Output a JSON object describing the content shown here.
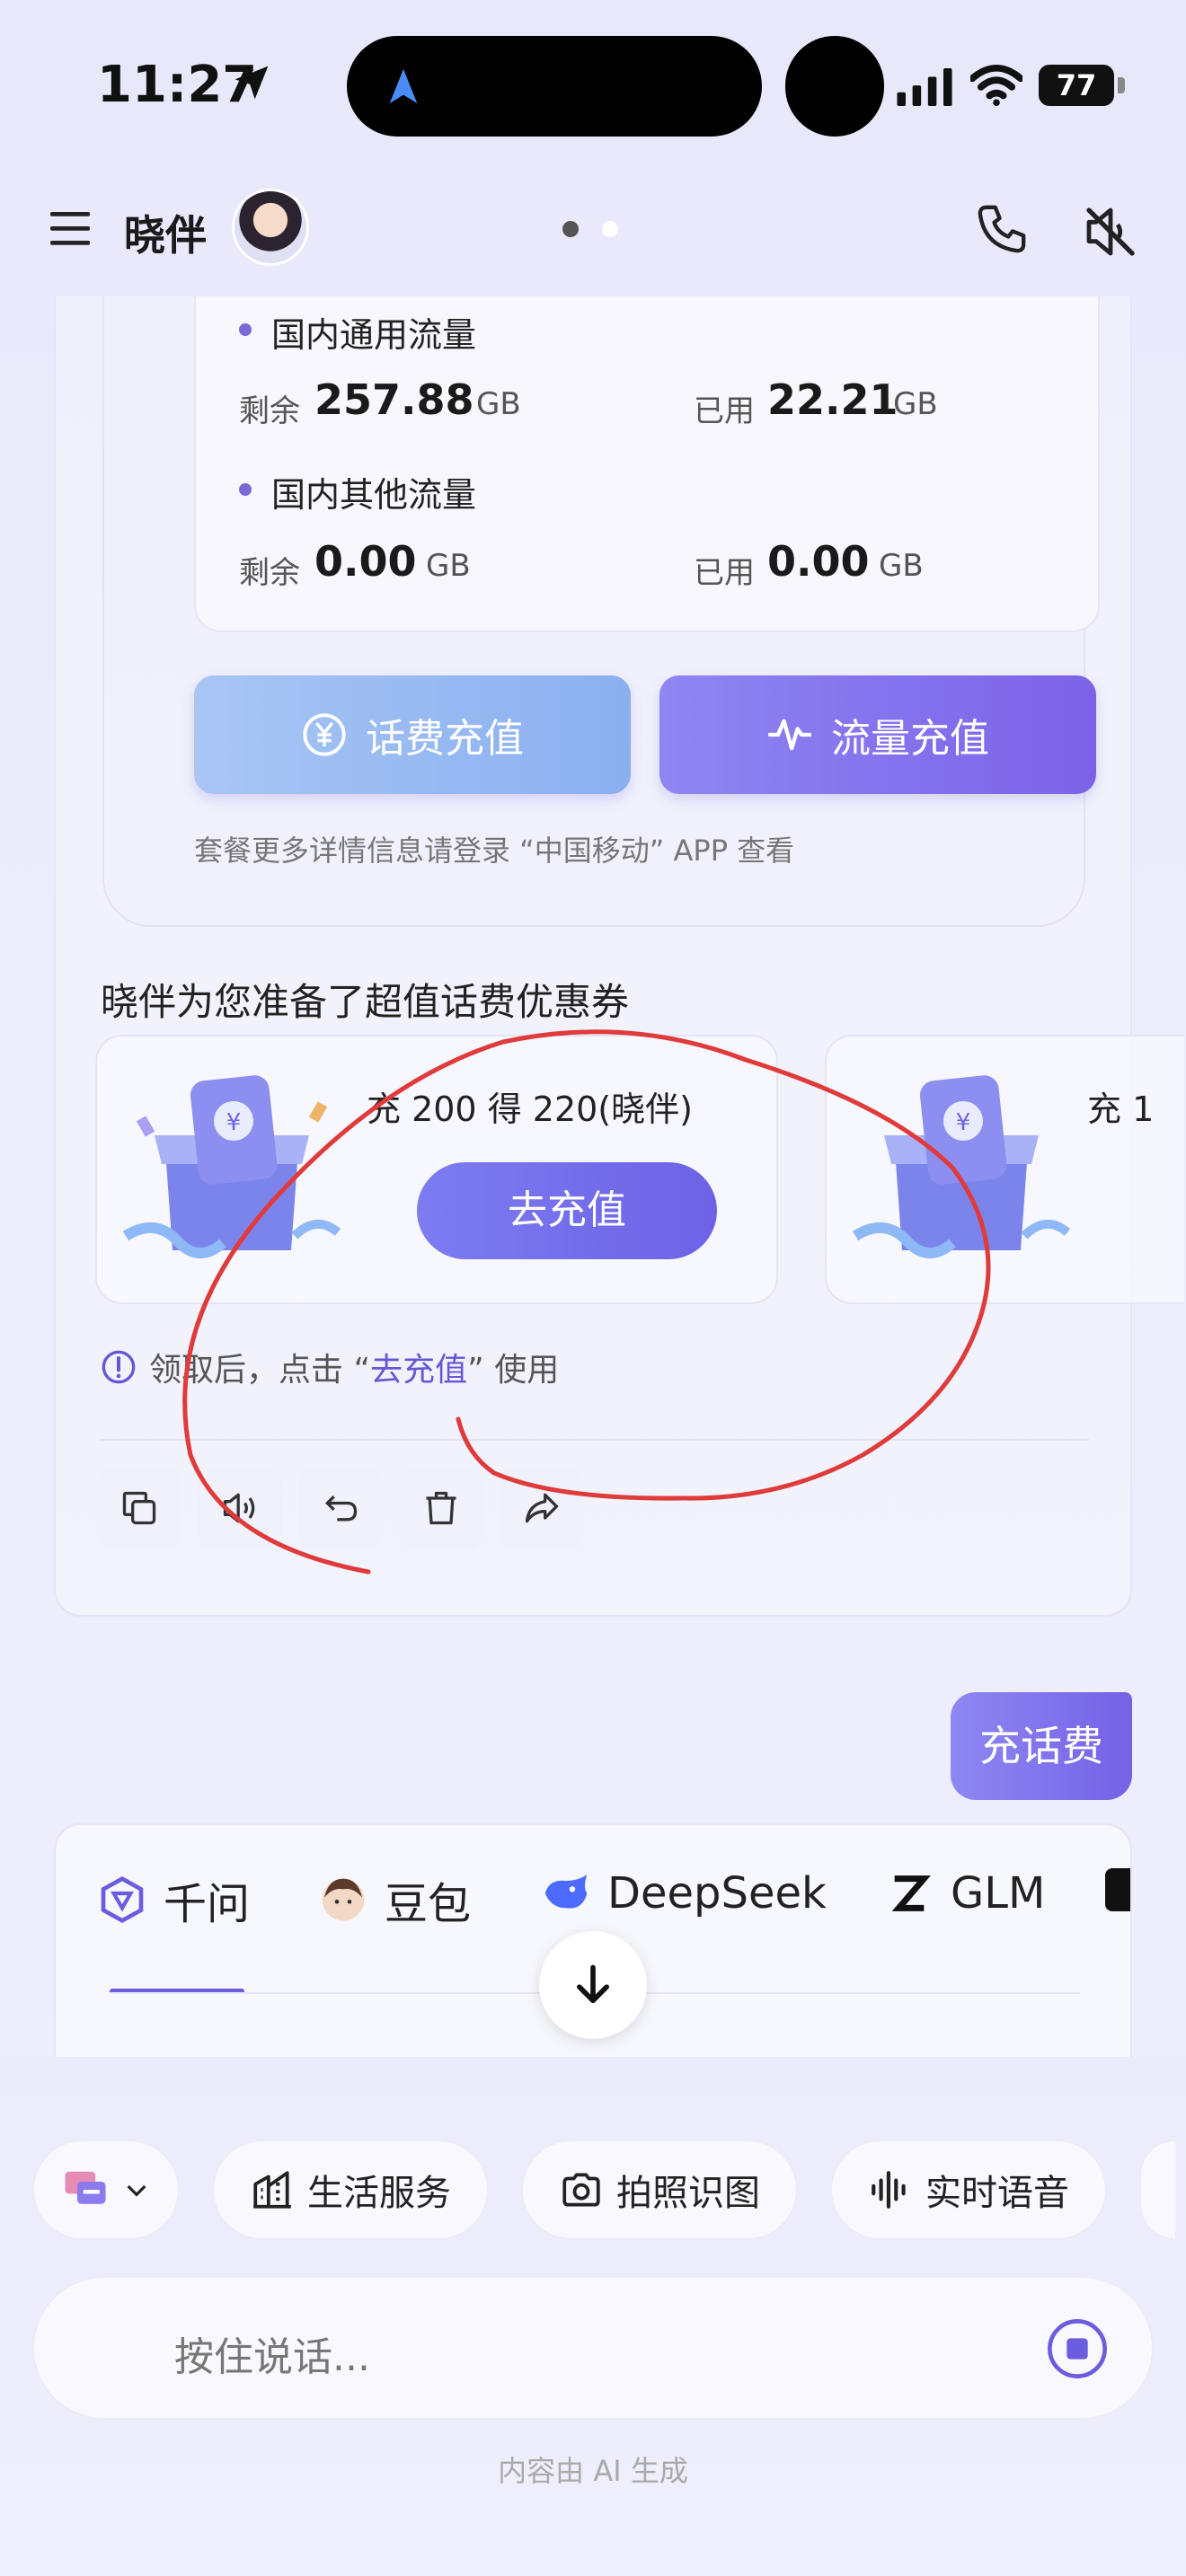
{
  "status_bar": {
    "time": "11:27",
    "battery": "77"
  },
  "header": {
    "title": "晓伴"
  },
  "plan": {
    "domestic_general": {
      "title": "国内通用流量",
      "remain_label": "剩余",
      "remain_value": "257.88",
      "remain_unit": "GB",
      "used_label": "已用",
      "used_value": "22.21",
      "used_unit": "GB"
    },
    "domestic_other": {
      "title": "国内其他流量",
      "remain_label": "剩余",
      "remain_value": "0.00",
      "remain_unit": "GB",
      "used_label": "已用",
      "used_value": "0.00",
      "used_unit": "GB"
    },
    "fee_recharge_label": "话费充值",
    "flow_recharge_label": "流量充值",
    "note": "套餐更多详情信息请登录 “中国移动” APP 查看"
  },
  "coupons": {
    "heading": "晓伴为您准备了超值话费优惠券",
    "items": [
      {
        "title": "充 200 得 220(晓伴)",
        "button": "去充值"
      },
      {
        "title": "充 1"
      }
    ],
    "hint_prefix": "领取后，点击 “",
    "hint_link": "去充值",
    "hint_suffix": "” 使用"
  },
  "user_message": "充话费",
  "models": {
    "tabs": [
      {
        "label": "千问",
        "icon": "qwen-icon"
      },
      {
        "label": "豆包",
        "icon": "doubao-icon"
      },
      {
        "label": "DeepSeek",
        "icon": "deepseek-icon"
      },
      {
        "label": "GLM",
        "icon": "glm-icon"
      }
    ]
  },
  "bottom": {
    "chips": [
      {
        "label": "生活服务",
        "icon": "building-icon"
      },
      {
        "label": "拍照识图",
        "icon": "camera-icon"
      },
      {
        "label": "实时语音",
        "icon": "waveform-icon"
      }
    ],
    "voice_placeholder": "按住说话...",
    "disclaimer": "内容由 AI 生成"
  },
  "colors": {
    "accent": "#6c5ce0",
    "annotation": "#e03a3a"
  }
}
